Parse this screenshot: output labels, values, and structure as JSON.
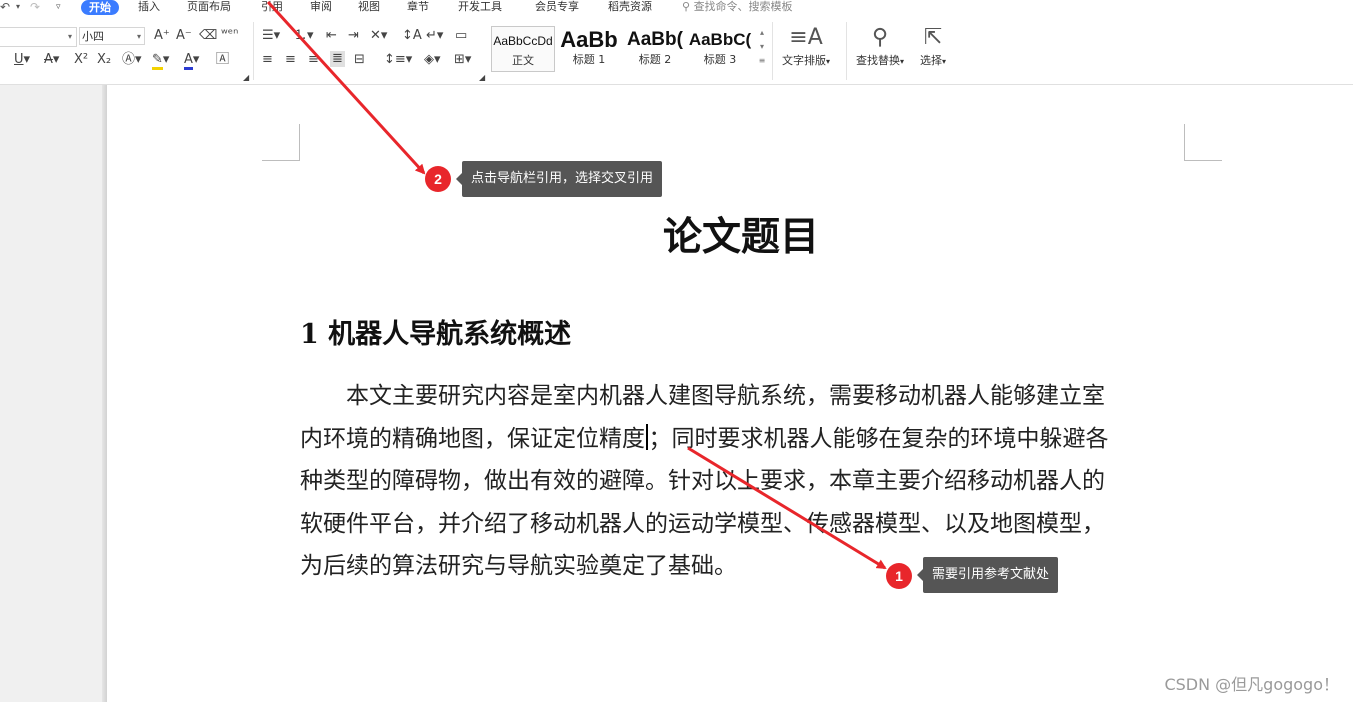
{
  "menu": {
    "tabs": [
      "开始",
      "插入",
      "页面布局",
      "引用",
      "审阅",
      "视图",
      "章节",
      "开发工具",
      "会员专享",
      "稻壳资源"
    ],
    "active_tab": "开始",
    "search_placeholder": "查找命令、搜索模板"
  },
  "ribbon": {
    "font_size": "小四",
    "styles": [
      {
        "sample": "AaBbCcDd",
        "label": "正文"
      },
      {
        "sample": "AaBb",
        "label": "标题 1"
      },
      {
        "sample": "AaBb(",
        "label": "标题 2"
      },
      {
        "sample": "AaBbC(",
        "label": "标题 3"
      }
    ],
    "text_layout_label": "文字排版",
    "find_replace_label": "查找替换",
    "select_label": "选择"
  },
  "document": {
    "title": "论文题目",
    "heading": "1 机器人导航系统概述",
    "body_lines": [
      "　　本文主要研究内容是室内机器人建图导航系统，需要移动机器人能够建立室",
      "内环境的精确地图，保证定位精度",
      "；同时要求机器人能够在复杂的环境中躲避各",
      "种类型的障碍物，做出有效的避障。针对以上要求，本章主要介绍移动机器人的",
      "软硬件平台，并介绍了移动机器人的运动学模型、传感器模型、以及地图模型，",
      "为后续的算法研究与导航实验奠定了基础。"
    ]
  },
  "annotations": [
    {
      "number": "1",
      "text": "需要引用参考文献处"
    },
    {
      "number": "2",
      "text": "点击导航栏引用，选择交叉引用"
    }
  ],
  "watermark": "CSDN @但凡gogogo！",
  "colors": {
    "accent": "#3b7cff",
    "badge": "#e8262b",
    "arrow": "#e8262b",
    "tooltip": "#555555"
  }
}
